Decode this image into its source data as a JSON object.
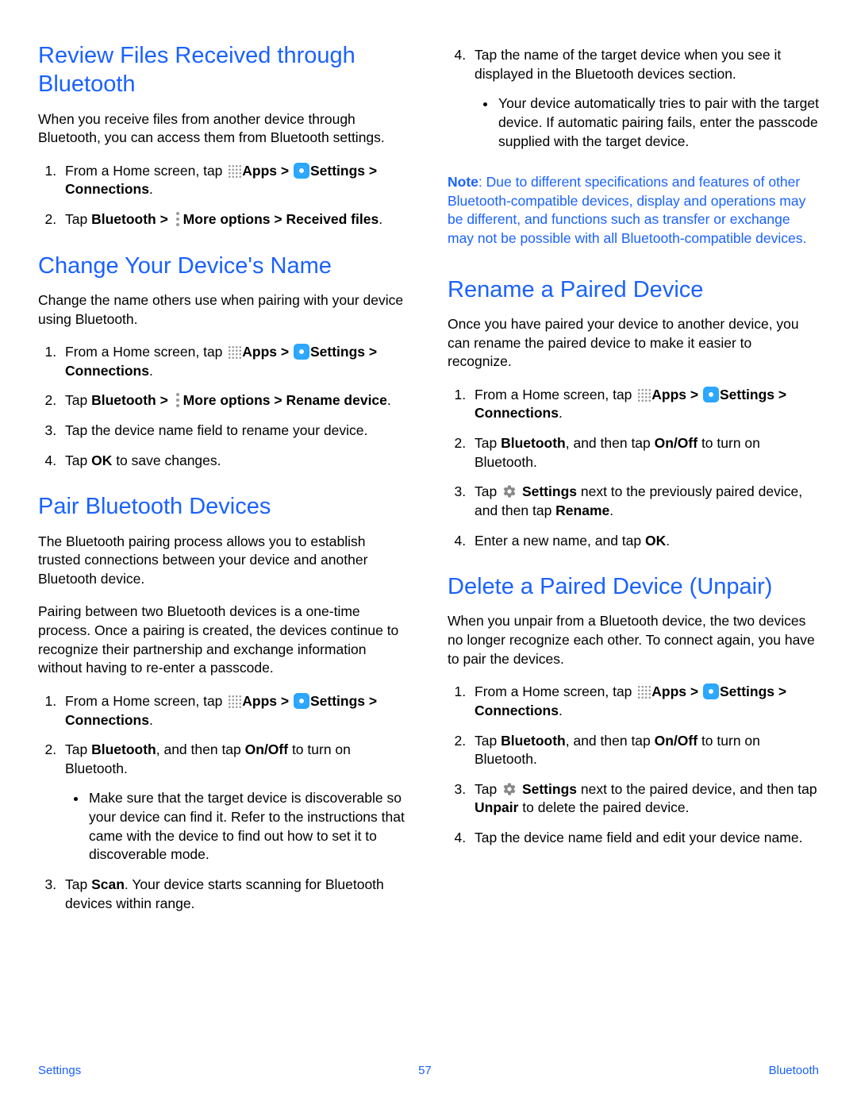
{
  "left": {
    "sec1": {
      "title": "Review Files Received through Bluetooth",
      "intro": "When you receive files from another device through Bluetooth, you can access them from Bluetooth settings.",
      "step1_a": "From a Home screen, tap ",
      "step1_apps": "Apps > ",
      "step1_settings": "Settings > Connections",
      "step1_end": ".",
      "step2_a": "Tap ",
      "step2_b": "Bluetooth > ",
      "step2_more": "More options > Received files",
      "step2_end": "."
    },
    "sec2": {
      "title": "Change Your Device's Name",
      "intro": "Change the name others use when pairing with your device using Bluetooth.",
      "step1_a": "From a Home screen, tap ",
      "step1_apps": "Apps > ",
      "step1_settings": "Settings > Connections",
      "step1_end": ".",
      "step2_a": "Tap ",
      "step2_b": "Bluetooth > ",
      "step2_more": "More options > Rename device",
      "step2_end": ".",
      "step3": "Tap the device name field to rename your device.",
      "step4_a": "Tap ",
      "step4_b": "OK",
      "step4_c": " to save changes."
    },
    "sec3": {
      "title": "Pair Bluetooth Devices",
      "p1": "The Bluetooth pairing process allows you to establish trusted connections between your device and another Bluetooth device.",
      "p2": "Pairing between two Bluetooth devices is a one-time process. Once a pairing is created, the devices continue to recognize their partnership and exchange information without having to re-enter a passcode.",
      "step1_a": "From a Home screen, tap ",
      "step1_apps": "Apps > ",
      "step1_settings": "Settings > Connections",
      "step1_end": ".",
      "step2_a": "Tap ",
      "step2_b": "Bluetooth",
      "step2_c": ", and then tap ",
      "step2_d": "On/Off",
      "step2_e": " to turn on Bluetooth.",
      "step2_bullet": "Make sure that the target device is discoverable so your device can find it. Refer to the instructions that came with the device to find out how to set it to discoverable mode.",
      "step3_a": "Tap ",
      "step3_b": "Scan",
      "step3_c": ". Your device starts scanning for Bluetooth devices within range."
    }
  },
  "right": {
    "sec3_cont": {
      "step4": "Tap the name of the target device when you see it displayed in the Bluetooth devices section.",
      "step4_bullet": "Your device automatically tries to pair with the target device. If automatic pairing fails, enter the passcode supplied with the target device."
    },
    "note_label": "Note",
    "note_text": ": Due to different specifications and features of other Bluetooth-compatible devices, display and operations may be different, and functions such as transfer or exchange may not be possible with all Bluetooth-compatible devices.",
    "sec4": {
      "title": "Rename a Paired Device",
      "intro": "Once you have paired your device to another device, you can rename the paired device to make it easier to recognize.",
      "step1_a": "From a Home screen, tap ",
      "step1_apps": "Apps > ",
      "step1_settings": "Settings > Connections",
      "step1_end": ".",
      "step2_a": "Tap ",
      "step2_b": "Bluetooth",
      "step2_c": ", and then tap ",
      "step2_d": "On/Off",
      "step2_e": " to turn on Bluetooth.",
      "step3_a": "Tap ",
      "step3_b": "Settings",
      "step3_c": " next to the previously paired device, and then tap ",
      "step3_d": "Rename",
      "step3_e": ".",
      "step4_a": "Enter a new name, and tap ",
      "step4_b": "OK",
      "step4_c": "."
    },
    "sec5": {
      "title": "Delete a Paired Device (Unpair)",
      "intro": "When you unpair from a Bluetooth device, the two devices no longer recognize each other. To connect again, you have to pair the devices.",
      "step1_a": "From a Home screen, tap ",
      "step1_apps": "Apps > ",
      "step1_settings": "Settings > Connections",
      "step1_end": ".",
      "step2_a": "Tap ",
      "step2_b": "Bluetooth",
      "step2_c": ", and then tap ",
      "step2_d": "On/Off",
      "step2_e": " to turn on Bluetooth.",
      "step3_a": "Tap ",
      "step3_b": "Settings",
      "step3_c": " next to the paired device, and then tap ",
      "step3_d": "Unpair",
      "step3_e": " to delete the paired device.",
      "step4": "Tap the device name field and edit your device name."
    }
  },
  "footer": {
    "left": "Settings",
    "mid": "57",
    "right": "Bluetooth"
  }
}
